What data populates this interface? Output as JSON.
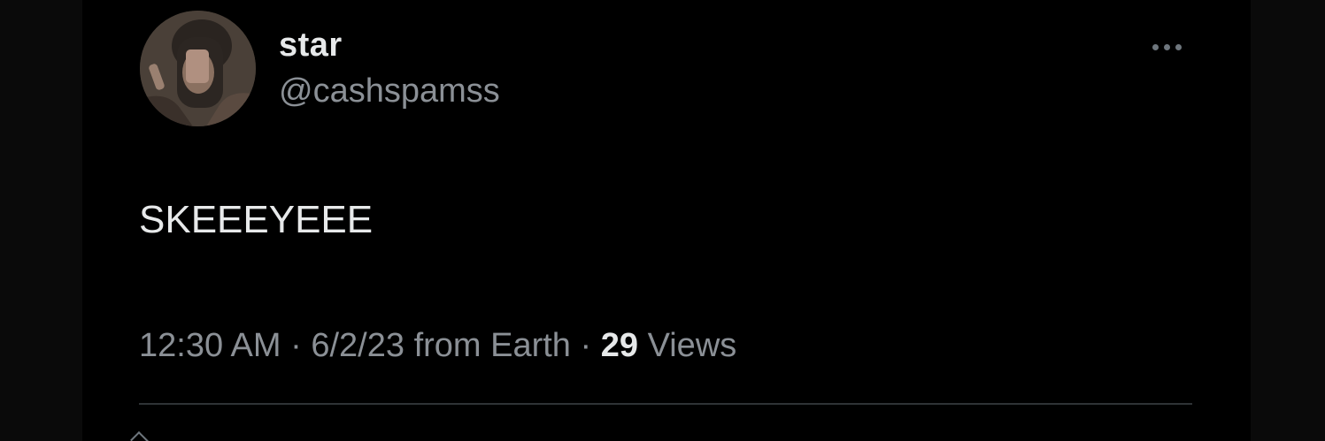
{
  "tweet": {
    "display_name": "star",
    "handle": "@cashspamss",
    "text": "SKEEEYEEE",
    "time": "12:30 AM",
    "date": "6/2/23",
    "source": "from Earth",
    "separator": "·",
    "views_count": "29",
    "views_label": "Views",
    "avatar_icon": "profile-photo",
    "more_icon": "more-options-icon"
  },
  "colors": {
    "background": "#000000",
    "primary_text": "#e7e9ea",
    "secondary_text": "#8b9096",
    "divider": "#2f3336"
  }
}
